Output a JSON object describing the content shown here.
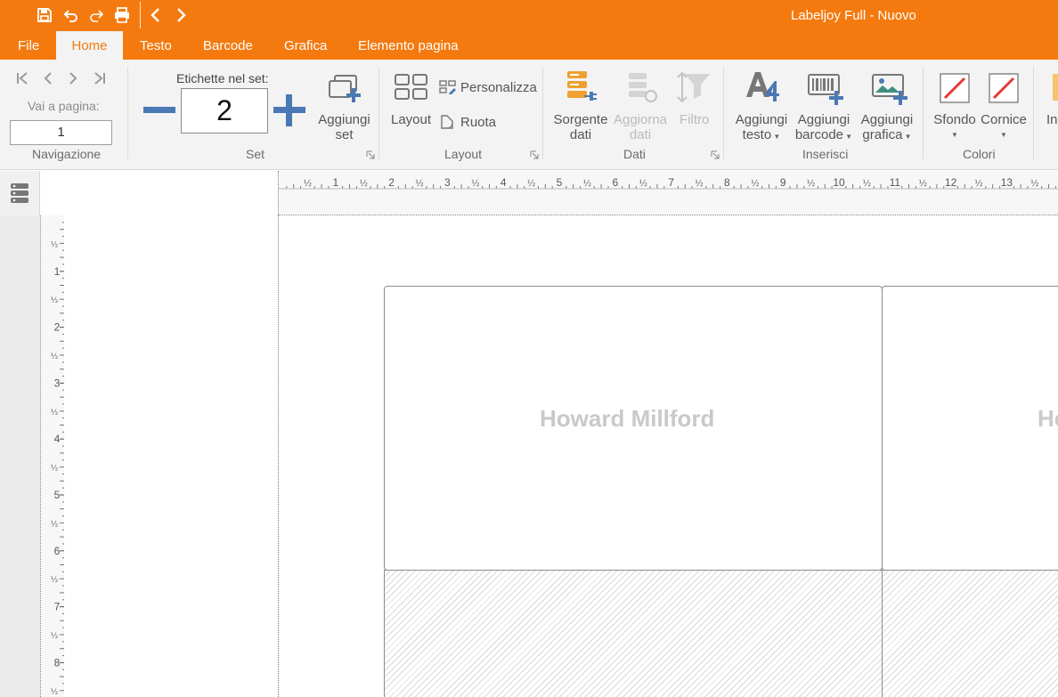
{
  "window": {
    "title": "Labeljoy Full - Nuovo"
  },
  "quick_access": {
    "save_icon": "save-icon",
    "undo_icon": "undo-icon",
    "redo_icon": "redo-icon",
    "print_icon": "print-icon",
    "back_icon": "chevron-left-icon",
    "forward_icon": "chevron-right-icon"
  },
  "menu_tabs": [
    {
      "label": "File",
      "active": false
    },
    {
      "label": "Home",
      "active": true
    },
    {
      "label": "Testo",
      "active": false
    },
    {
      "label": "Barcode",
      "active": false
    },
    {
      "label": "Grafica",
      "active": false
    },
    {
      "label": "Elemento pagina",
      "active": false
    }
  ],
  "ribbon": {
    "navigation": {
      "goto_label": "Vai a pagina:",
      "goto_value": "1",
      "group_label": "Navigazione"
    },
    "set": {
      "count_label": "Etichette nel set:",
      "count_value": "2",
      "add_set_line1": "Aggiungi",
      "add_set_line2": "set",
      "group_label": "Set"
    },
    "layout": {
      "layout_label": "Layout",
      "customize_label": "Personalizza",
      "rotate_label": "Ruota",
      "group_label": "Layout"
    },
    "data": {
      "source_line1": "Sorgente",
      "source_line2": "dati",
      "refresh_line1": "Aggiorna",
      "refresh_line2": "dati",
      "filter_label": "Filtro",
      "group_label": "Dati"
    },
    "insert": {
      "add_text_line1": "Aggiungi",
      "add_text_line2": "testo",
      "add_barcode_line1": "Aggiungi",
      "add_barcode_line2": "barcode",
      "add_graphic_line1": "Aggiungi",
      "add_graphic_line2": "grafica",
      "group_label": "Inserisci"
    },
    "colors": {
      "background_label": "Sfondo",
      "border_label": "Cornice",
      "group_label": "Colori"
    },
    "overflow_label": "In"
  },
  "ruler": {
    "horizontal_numbers": [
      "1",
      "2",
      "3",
      "4",
      "5",
      "6",
      "7",
      "8",
      "9",
      "10",
      "11",
      "12",
      "13"
    ],
    "vertical_numbers": [
      "1",
      "2",
      "3",
      "4",
      "5",
      "6",
      "7",
      "8"
    ],
    "half_mark": "½"
  },
  "labels": [
    {
      "name": "Howard Millford"
    },
    {
      "name": "Ho"
    }
  ],
  "colors": {
    "accent": "#f47a0f",
    "ribbon_bg": "#f3f3f3",
    "icon_blue": "#4a78b5",
    "icon_orange": "#f0a030",
    "swatch_red": "#e53935"
  }
}
